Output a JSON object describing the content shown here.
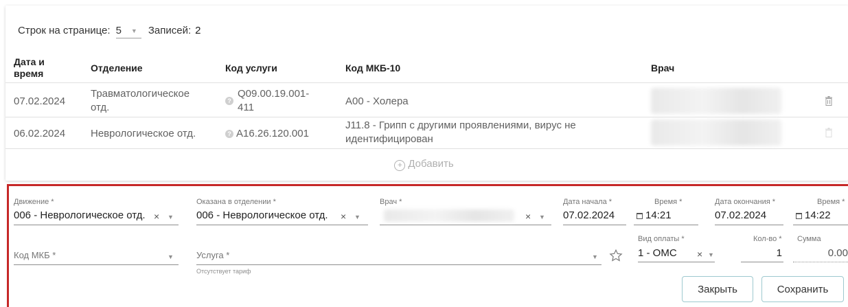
{
  "pager": {
    "rows_label": "Строк на странице:",
    "rows_value": "5",
    "records_label": "Записей:",
    "records_value": "2"
  },
  "table": {
    "headers": {
      "date": "Дата и время",
      "dept": "Отделение",
      "service": "Код услуги",
      "mkb": "Код МКБ-10",
      "doctor": "Врач"
    },
    "rows": [
      {
        "date": "07.02.2024",
        "dept": "Травматологическое отд.",
        "service": "Q09.00.19.001-411",
        "mkb": "A00 - Холера"
      },
      {
        "date": "06.02.2024",
        "dept": "Неврологическое отд.",
        "service": "A16.26.120.001",
        "mkb": "J11.8 - Грипп с другими проявлениями, вирус не идентифицирован"
      }
    ],
    "add_label": "Добавить"
  },
  "form": {
    "movement": {
      "label": "Движение *",
      "value": "006 - Неврологическое отд."
    },
    "dept": {
      "label": "Оказана в отделении *",
      "value": "006 - Неврологическое отд."
    },
    "doctor": {
      "label": "Врач *"
    },
    "start_date": {
      "label": "Дата начала *",
      "value": "07.02.2024"
    },
    "start_time": {
      "label": "Время *",
      "value": "14:21"
    },
    "end_date": {
      "label": "Дата окончания *",
      "value": "07.02.2024"
    },
    "end_time": {
      "label": "Время *",
      "value": "14:22"
    },
    "mkb": {
      "placeholder": "Код МКБ *"
    },
    "service": {
      "placeholder": "Услуга *",
      "hint": "Отсутствует тариф"
    },
    "payment": {
      "label": "Вид оплаты *",
      "value": "1 - ОМС"
    },
    "qty": {
      "label": "Кол-во *",
      "value": "1"
    },
    "sum": {
      "label": "Сумма",
      "value": "0.00"
    },
    "close_label": "Закрыть",
    "save_label": "Сохранить"
  },
  "colors": {
    "highlight_border": "#c62828",
    "button_border": "#9ec9cf"
  }
}
